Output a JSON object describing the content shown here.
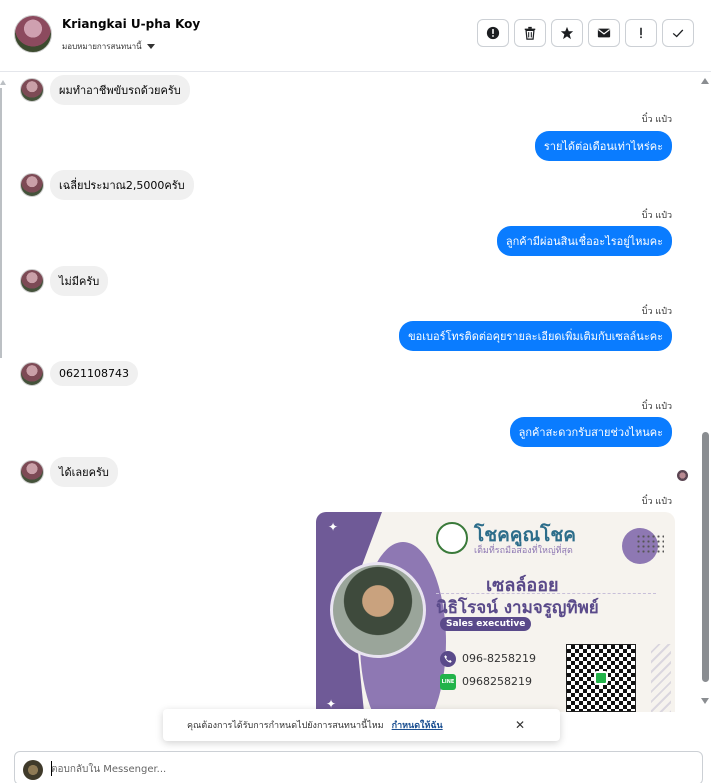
{
  "header": {
    "name": "Kriangkai U-pha Koy",
    "subtitle": "มอบหมายการสนทนานี้"
  },
  "actions": [
    {
      "name": "report-icon",
      "label": "report"
    },
    {
      "name": "trash-icon",
      "label": "delete"
    },
    {
      "name": "star-icon",
      "label": "star"
    },
    {
      "name": "mail-icon",
      "label": "mark unread"
    },
    {
      "name": "exclamation-icon",
      "label": "spam"
    },
    {
      "name": "check-icon",
      "label": "done"
    }
  ],
  "messages": [
    {
      "dir": "in",
      "text": "ผมทำอาชีพขับรถด้วยครับ"
    },
    {
      "dir": "out",
      "sender": "บิ๋ว แป๋ว",
      "text": "รายได้ต่อเดือนเท่าไหร่คะ"
    },
    {
      "dir": "in",
      "text": "เฉลี่ยประมาณ2,5000ครับ"
    },
    {
      "dir": "out",
      "sender": "บิ๋ว แป๋ว",
      "text": "ลูกค้ามีผ่อนสินเชื่ออะไรอยู่ไหมคะ"
    },
    {
      "dir": "in",
      "text": "ไม่มีครับ"
    },
    {
      "dir": "out",
      "sender": "บิ๋ว แป๋ว",
      "text": "ขอเบอร์โทรติดต่อคุยรายละเอียดเพิ่มเติมกับเซลล์นะคะ"
    },
    {
      "dir": "in",
      "text": "0621108743"
    },
    {
      "dir": "out",
      "sender": "บิ๋ว แป๋ว",
      "text": "ลูกค้าสะดวกรับสายช่วงไหนคะ"
    },
    {
      "dir": "in",
      "text": "ได้เลยครับ"
    },
    {
      "dir": "out",
      "sender": "บิ๋ว แป๋ว",
      "text": ""
    }
  ],
  "card": {
    "brand": "โชคคูณโชค",
    "tagline": "เต็มที่รถมือสองที่ใหญ่ที่สุด",
    "role": "เซลล์ออย",
    "person": "นิธิโรจน์  งามจรูญทิพย์",
    "title": "Sales executive",
    "phone": "096-8258219",
    "line": "0968258219",
    "line_icon_text": "LINE"
  },
  "toast": {
    "text": "คุณต้องการได้รับการกำหนดไปยังการสนทนานี้ไหม",
    "link": "กำหนดให้ฉัน",
    "close": "✕"
  },
  "composer": {
    "placeholder": "ตอบกลับใน Messenger..."
  }
}
